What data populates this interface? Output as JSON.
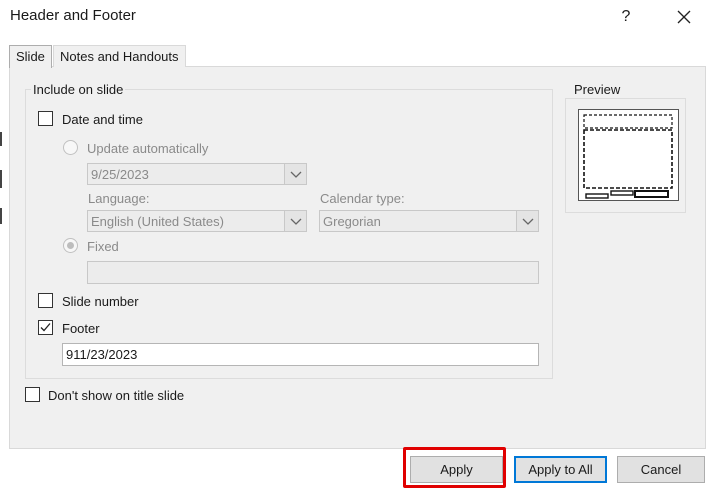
{
  "dialog": {
    "title": "Header and Footer",
    "help": "?",
    "close_icon": "close-icon"
  },
  "tabs": [
    {
      "label": "Slide",
      "active": true
    },
    {
      "label": "Notes and Handouts",
      "active": false
    }
  ],
  "include_group": {
    "label": "Include on slide",
    "date_time": {
      "label": "Date and time",
      "checked": false
    },
    "update_auto": {
      "label": "Update automatically",
      "selected": false,
      "enabled": false
    },
    "date_value": "9/25/2023",
    "language": {
      "label": "Language:",
      "value": "English (United States)"
    },
    "calendar": {
      "label": "Calendar type:",
      "value": "Gregorian"
    },
    "fixed": {
      "label": "Fixed",
      "selected": true,
      "enabled": false,
      "value": ""
    },
    "slide_number": {
      "label": "Slide number",
      "checked": false
    },
    "footer": {
      "label": "Footer",
      "checked": true,
      "value": "911/23/2023"
    }
  },
  "dont_show_title": {
    "label": "Don't show on title slide",
    "checked": false
  },
  "preview": {
    "label": "Preview"
  },
  "buttons": {
    "apply": "Apply",
    "apply_all": "Apply to All",
    "cancel": "Cancel"
  },
  "colors": {
    "accent": "#0078d7",
    "highlight": "#e00000"
  }
}
